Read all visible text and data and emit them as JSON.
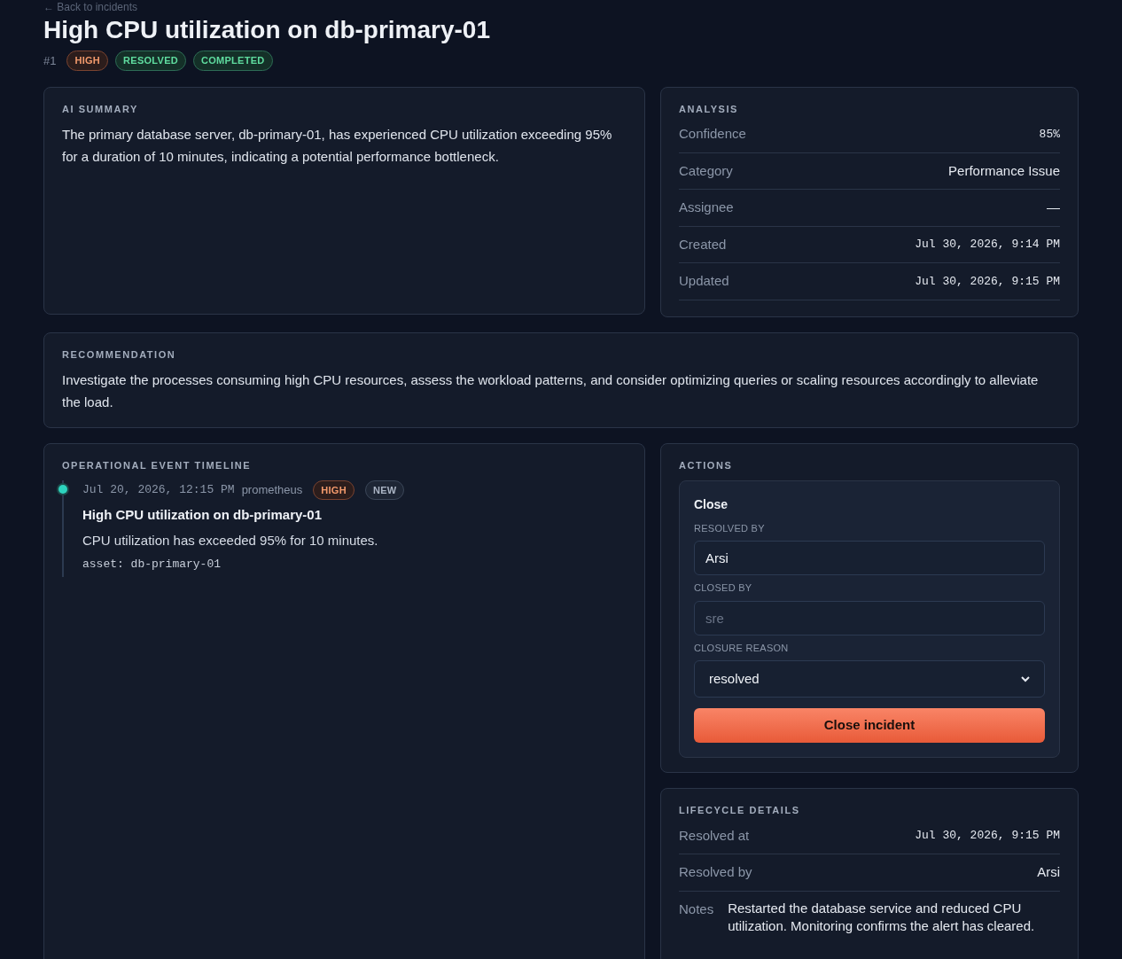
{
  "back_link": "← Back to incidents",
  "title": "High CPU utilization on db-primary-01",
  "id": "#1",
  "badges": [
    {
      "label": "HIGH",
      "kind": "severity"
    },
    {
      "label": "RESOLVED",
      "kind": "success"
    },
    {
      "label": "COMPLETED",
      "kind": "success"
    }
  ],
  "ai_summary": {
    "heading": "AI SUMMARY",
    "text": "The primary database server, db-primary-01, has experienced CPU utilization exceeding 95% for a duration of 10 minutes, indicating a potential performance bottleneck."
  },
  "analysis": {
    "heading": "ANALYSIS",
    "rows": [
      {
        "label": "Confidence",
        "value": "85%",
        "kind": "mono"
      },
      {
        "label": "Category",
        "value": "Performance Issue",
        "kind": "text"
      },
      {
        "label": "Assignee",
        "value": "—",
        "kind": "text"
      },
      {
        "label": "Created",
        "value": "Jul 30, 2026, 9:14 PM",
        "kind": "mono"
      },
      {
        "label": "Updated",
        "value": "Jul 30, 2026, 9:15 PM",
        "kind": "mono"
      }
    ]
  },
  "recommendation": {
    "heading": "RECOMMENDATION",
    "text": "Investigate the processes consuming high CPU resources, assess the workload patterns, and consider optimizing queries or scaling resources accordingly to alleviate the load."
  },
  "timeline": {
    "heading": "OPERATIONAL EVENT TIMELINE",
    "events": [
      {
        "time": "Jul 20, 2026, 12:15 PM",
        "source": "prometheus",
        "badges": [
          {
            "label": "HIGH",
            "kind": "severity"
          },
          {
            "label": "NEW",
            "kind": "neutral"
          }
        ],
        "title": "High CPU utilization on db-primary-01",
        "description": "CPU utilization has exceeded 95% for 10 minutes.",
        "meta": "asset: db-primary-01"
      }
    ]
  },
  "actions": {
    "heading": "ACTIONS",
    "form_title": "Close",
    "fields": [
      {
        "label": "RESOLVED BY",
        "kind": "input",
        "value": "Arsi"
      },
      {
        "label": "CLOSED BY",
        "kind": "input",
        "placeholder": "sre"
      },
      {
        "label": "CLOSURE REASON",
        "kind": "select",
        "value": "resolved"
      }
    ],
    "button": "Close incident"
  },
  "lifecycle": {
    "heading": "LIFECYCLE DETAILS",
    "rows": [
      {
        "label": "Resolved at",
        "value": "Jul 30, 2026, 9:15 PM",
        "kind": "mono"
      },
      {
        "label": "Resolved by",
        "value": "Arsi",
        "kind": "text"
      },
      {
        "label": "Notes",
        "value": "Restarted the database service and reduced CPU utilization. Monitoring confirms the alert has cleared.",
        "kind": "note"
      }
    ]
  }
}
